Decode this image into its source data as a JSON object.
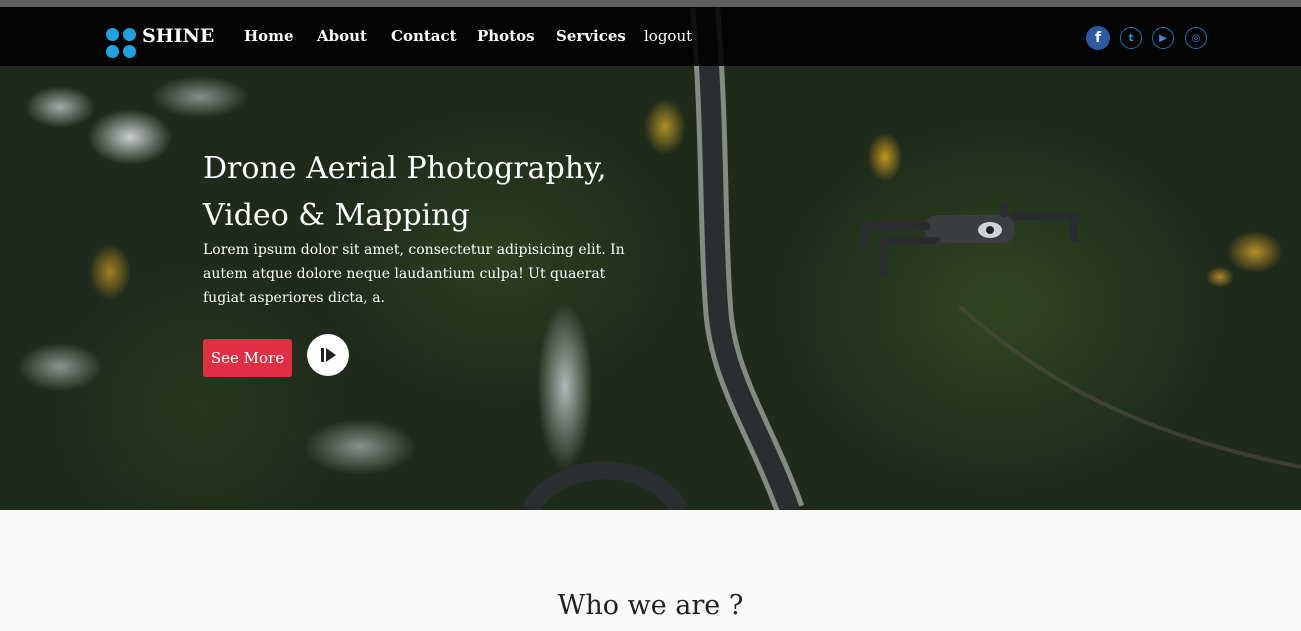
{
  "brand": {
    "name": "SHINE",
    "logo_icon": "drone-logo-icon",
    "accent": "#1fa2e0"
  },
  "nav": {
    "links": [
      "Home",
      "About",
      "Contact",
      "Photos",
      "Services",
      "logout"
    ]
  },
  "social": [
    {
      "icon": "facebook-icon",
      "glyph": "f"
    },
    {
      "icon": "twitter-icon",
      "glyph": "t"
    },
    {
      "icon": "youtube-icon",
      "glyph": "▶"
    },
    {
      "icon": "instagram-icon",
      "glyph": "◎"
    }
  ],
  "hero": {
    "headline_line1": "Drone Aerial Photography,",
    "headline_line2": "Video & Mapping",
    "paragraph": "Lorem ipsum dolor sit amet, consectetur adipisicing elit. In autem atque dolore neque laudantium culpa! Ut quaerat fugiat asperiores dicta, a.",
    "cta_label": "See More",
    "cta_color": "#e02e44"
  },
  "about": {
    "title": "Who we are ?"
  }
}
